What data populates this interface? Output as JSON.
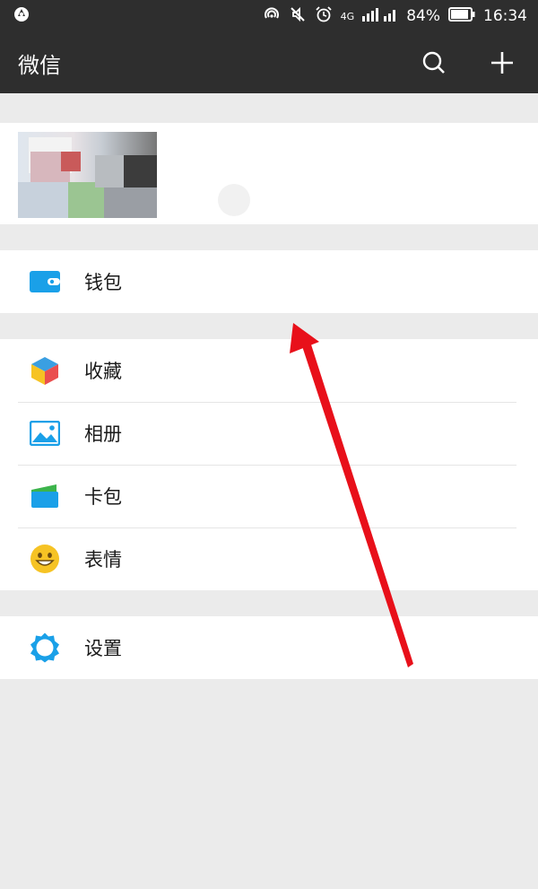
{
  "status_bar": {
    "network": "4G",
    "battery": "84%",
    "time": "16:34"
  },
  "header": {
    "title": "微信"
  },
  "menu": {
    "wallet": "钱包",
    "favorites": "收藏",
    "album": "相册",
    "cards": "卡包",
    "stickers": "表情",
    "settings": "设置"
  },
  "colors": {
    "bar": "#2e2e2e",
    "accent_blue": "#1aa0e8",
    "emoji_yellow": "#f6c324",
    "arrow_red": "#e8101a"
  },
  "icons": [
    "app-icon",
    "nfc-icon",
    "mute-icon",
    "alarm-icon",
    "signal-icon",
    "battery-icon",
    "search-icon",
    "plus-icon",
    "wallet-icon",
    "favorites-cube-icon",
    "album-icon",
    "card-icon",
    "emoji-icon",
    "gear-icon"
  ]
}
